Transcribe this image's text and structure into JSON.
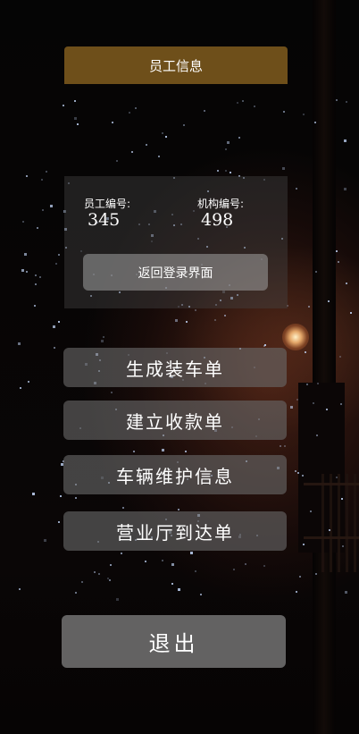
{
  "header": {
    "title": "员工信息"
  },
  "info": {
    "employee_id_label": "员工编号:",
    "employee_id": "345",
    "org_id_label": "机构编号:",
    "org_id": "498"
  },
  "actions": {
    "return_login": "返回登录界面",
    "menu": [
      "生成装车单",
      "建立收款单",
      "车辆维护信息",
      "营业厅到达单"
    ],
    "exit": "退出"
  },
  "theme": {
    "title_bar_color": "#6e4f1a",
    "button_color": "#696969",
    "text_color": "#ffffff"
  }
}
